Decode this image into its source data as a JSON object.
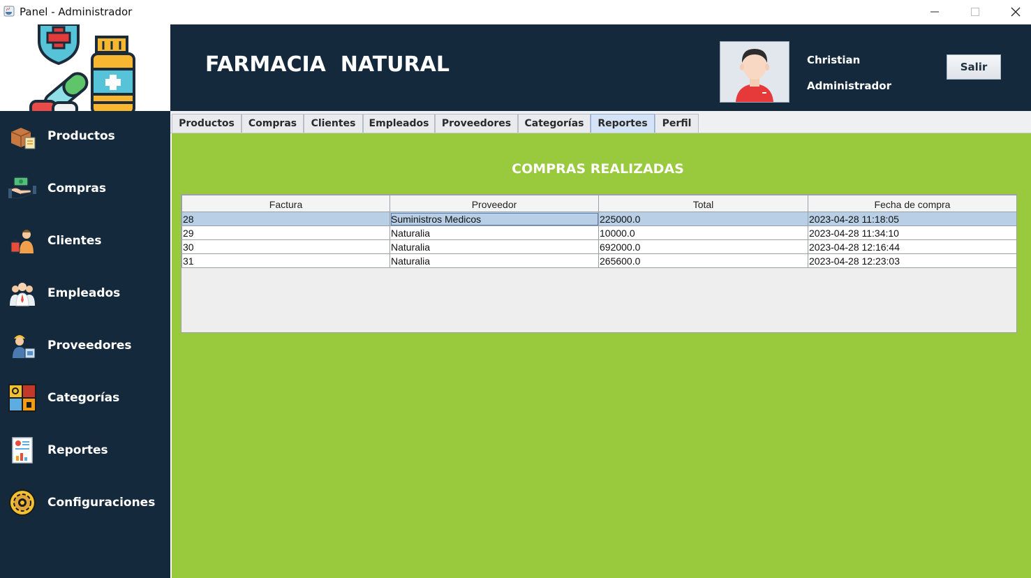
{
  "window": {
    "title": "Panel - Administrador"
  },
  "header": {
    "brand": "FARMACIA  NATURAL",
    "user_name": "Christian",
    "user_role": "Administrador",
    "logout_label": "Salir"
  },
  "sidebar": {
    "items": [
      {
        "label": "Productos",
        "icon": "boxes-icon"
      },
      {
        "label": "Compras",
        "icon": "handshake-money-icon"
      },
      {
        "label": "Clientes",
        "icon": "customer-icon"
      },
      {
        "label": "Empleados",
        "icon": "employees-icon"
      },
      {
        "label": "Proveedores",
        "icon": "supplier-icon"
      },
      {
        "label": "Categorías",
        "icon": "categories-icon"
      },
      {
        "label": "Reportes",
        "icon": "report-icon"
      },
      {
        "label": "Configuraciones",
        "icon": "gear-icon"
      }
    ]
  },
  "tabs": [
    {
      "label": "Productos"
    },
    {
      "label": "Compras"
    },
    {
      "label": "Clientes"
    },
    {
      "label": "Empleados"
    },
    {
      "label": "Proveedores"
    },
    {
      "label": "Categorías"
    },
    {
      "label": "Reportes",
      "active": true
    },
    {
      "label": "Perfil"
    }
  ],
  "report": {
    "title": "COMPRAS REALIZADAS",
    "columns": [
      "Factura",
      "Proveedor",
      "Total",
      "Fecha de compra"
    ],
    "rows": [
      [
        "28",
        "Suministros Medicos",
        "225000.0",
        "2023-04-28 11:18:05"
      ],
      [
        "29",
        "Naturalia",
        "10000.0",
        "2023-04-28 11:34:10"
      ],
      [
        "30",
        "Naturalia",
        "692000.0",
        "2023-04-28 12:16:44"
      ],
      [
        "31",
        "Naturalia",
        "265600.0",
        "2023-04-28 12:23:03"
      ]
    ],
    "selected_row": 0
  },
  "colors": {
    "header_bg": "#142a3c",
    "content_bg": "#99c93d",
    "selected_row": "#b8cfe5"
  }
}
